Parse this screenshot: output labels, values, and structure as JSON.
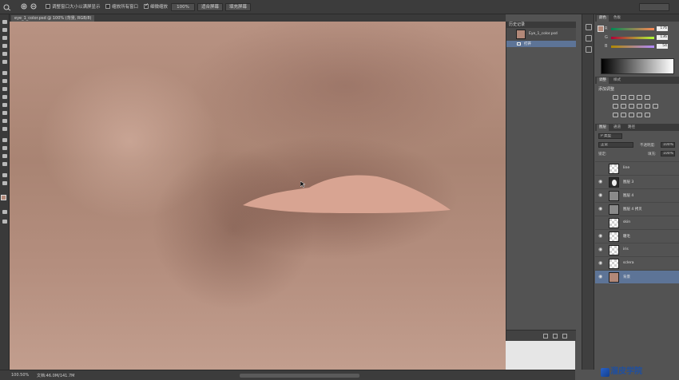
{
  "colors": {
    "selection": "#5d7497",
    "accent": "#1f4fa0"
  },
  "options_bar": {
    "items": [
      "调整窗口大小以满屏显示",
      "缩放所有窗口",
      "细微缩放",
      "100%",
      "适合屏幕",
      "填充屏幕"
    ]
  },
  "document": {
    "tab_title": "eye_1_color.psd @ 100% (背景, RGB/8)"
  },
  "status_bar": {
    "zoom": "100.50%",
    "doc_info": "文档:46.0M/141.7M"
  },
  "history": {
    "header": "历史记录",
    "snapshot_label": "Eye_1_color.psd",
    "entry": "打开"
  },
  "color_panel": {
    "tabs": [
      "颜色",
      "色板"
    ],
    "channels": [
      {
        "label": "R",
        "value": "176"
      },
      {
        "label": "G",
        "value": "136"
      },
      {
        "label": "B",
        "value": "54"
      }
    ]
  },
  "adjustments": {
    "tabs": [
      "调整",
      "样式"
    ],
    "title": "添加调整"
  },
  "layers": {
    "tabs": [
      "图层",
      "通道",
      "路径"
    ],
    "filter_kind": "P 类型",
    "blend_mode": "正常",
    "opacity_label": "不透明度:",
    "opacity_value": "100%",
    "lock_label": "锁定:",
    "fill_label": "填充:",
    "fill_value": "100%",
    "rows": [
      {
        "name": "line"
      },
      {
        "name": "图层 3"
      },
      {
        "name": "图层 4"
      },
      {
        "name": "图层 4 拷贝"
      },
      {
        "name": "skin"
      },
      {
        "name": "睫毛"
      },
      {
        "name": "iris"
      },
      {
        "name": "sclera"
      },
      {
        "name": "背景"
      }
    ]
  },
  "watermark": {
    "text": "溜皮学院"
  }
}
